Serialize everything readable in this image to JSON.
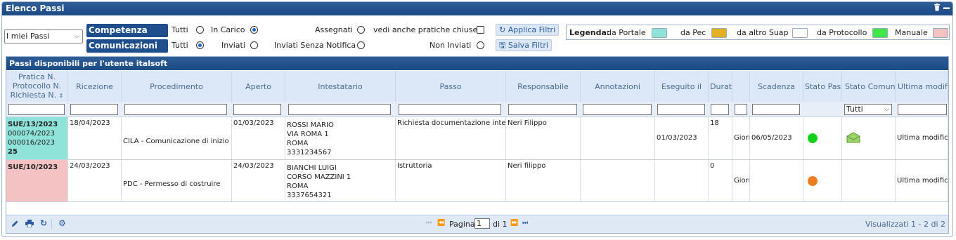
{
  "window": {
    "title": "Elenco Passi"
  },
  "filters": {
    "view_select": "I miei Passi",
    "competenza_label": "Competenza",
    "comunicazioni_label": "Comunicazioni",
    "comp_tutti": "Tutti",
    "comp_in_carico": "In Carico",
    "comp_assegnati": "Assegnati",
    "comp_chiuse": "vedi anche pratiche chiuse",
    "com_tutti": "Tutti",
    "com_inviati": "Inviati",
    "com_senza_notifica": "Inviati Senza Notifica",
    "com_non_inviati": "Non Inviati",
    "apply_button": "Applica Filtri",
    "save_button": "Salva Filtri"
  },
  "legend": {
    "title": "Legenda:",
    "items": [
      {
        "label": "da Portale",
        "color": "#8fe3d9"
      },
      {
        "label": "da Pec",
        "color": "#e2b020"
      },
      {
        "label": "da altro Suap",
        "color": "#ffffff"
      },
      {
        "label": "da Protocollo",
        "color": "#3ee64a"
      },
      {
        "label": "Manuale",
        "color": "#f4c2c2"
      }
    ]
  },
  "grid": {
    "title": "Passi disponibili per l'utente italsoft",
    "columns": {
      "pratica": [
        "Pratica N.",
        "Protocollo N.",
        "Richiesta N."
      ],
      "ricezione": "Ricezione",
      "procedimento": "Procedimento",
      "aperto": "Aperto",
      "intestatario": "Intestatario",
      "passo": "Passo",
      "responsabile": "Responsabile",
      "annotazioni": "Annotazioni",
      "eseguito": "Eseguito il",
      "durata": "Durata",
      "scadenza": "Scadenza",
      "stato_passo": "Stato Passo",
      "stato_comun": "Stato Comun.",
      "ultima": "Ultima modifica"
    },
    "stato_comun_filter": "Tutti",
    "rows": [
      {
        "pratica": "SUE/13/2023",
        "protocollo": "000074/2023",
        "richiesta": "000016/2023",
        "extra": "25",
        "origin_color": "#8fe3d9",
        "ricezione": "18/04/2023",
        "procedimento": "CILA - Comunicazione di inizio lavori",
        "aperto": "01/03/2023",
        "intestatario": [
          "ROSSI MARIO",
          "VIA ROMA 1",
          "ROMA",
          "3331234567"
        ],
        "passo": "Richiesta documentazione integrativa",
        "responsabile": "Neri Filippo",
        "annotazioni": "",
        "eseguito": "01/03/2023",
        "durata": "18",
        "unita": "Giorni",
        "scadenza": "06/05/2023",
        "stato_color": "#12d11a",
        "comun_icon": "sent-envelope-icon",
        "ultima": "Ultima modifica alle"
      },
      {
        "pratica": "SUE/10/2023",
        "protocollo": "",
        "richiesta": "",
        "extra": "",
        "origin_color": "#f4c2c2",
        "ricezione": "24/03/2023",
        "procedimento": "PDC - Permesso di costruire",
        "aperto": "24/03/2023",
        "intestatario": [
          "BIANCHI LUIGI",
          "CORSO MAZZINI 1",
          "ROMA",
          "3337654321"
        ],
        "passo": "Istruttoria",
        "responsabile": "Neri filippo",
        "annotazioni": "",
        "eseguito": "",
        "durata": "0",
        "unita": "Giorni",
        "scadenza": "",
        "stato_color": "#f07d20",
        "comun_icon": "",
        "ultima": "Ultima modifica alle"
      }
    ]
  },
  "pager": {
    "page_label": "Pagina",
    "page_value": "1",
    "of_label": "di 1",
    "summary": "Visualizzati 1 - 2 di 2"
  }
}
